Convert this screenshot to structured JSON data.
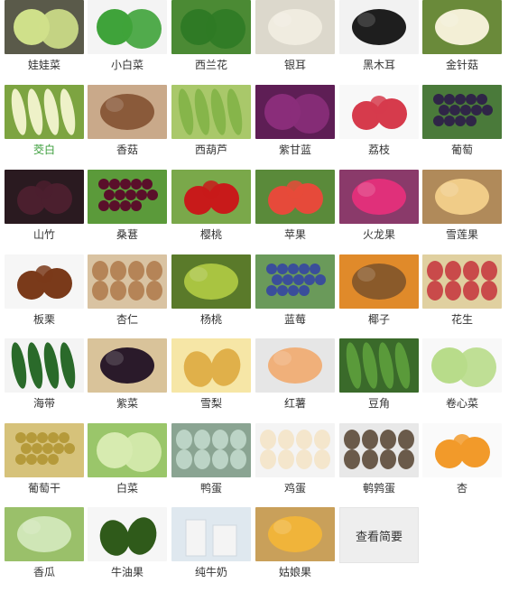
{
  "items": [
    {
      "name": "娃娃菜",
      "icon": "baby-cabbage-icon",
      "color": "#cfe08a",
      "bg": "#5a5a4a"
    },
    {
      "name": "小白菜",
      "icon": "bok-choy-icon",
      "color": "#3fa33a",
      "bg": "#f4f4f4"
    },
    {
      "name": "西兰花",
      "icon": "broccoli-icon",
      "color": "#2f7a25",
      "bg": "#4b8a34"
    },
    {
      "name": "银耳",
      "icon": "white-fungus-icon",
      "color": "#f0ece0",
      "bg": "#dcd8cc"
    },
    {
      "name": "黑木耳",
      "icon": "black-fungus-icon",
      "color": "#1e1e1e",
      "bg": "#f2f2f2"
    },
    {
      "name": "金针菇",
      "icon": "enoki-icon",
      "color": "#f3efd6",
      "bg": "#6a8a3a"
    },
    {
      "name": "茭白",
      "icon": "water-bamboo-icon",
      "color": "#eef1c8",
      "bg": "#7da441",
      "active": true
    },
    {
      "name": "香菇",
      "icon": "shiitake-icon",
      "color": "#8a5a3a",
      "bg": "#c9a98a"
    },
    {
      "name": "西葫芦",
      "icon": "zucchini-icon",
      "color": "#86b54a",
      "bg": "#a9c86a"
    },
    {
      "name": "紫甘蓝",
      "icon": "red-cabbage-icon",
      "color": "#8a2d7a",
      "bg": "#5e1e55"
    },
    {
      "name": "荔枝",
      "icon": "lychee-icon",
      "color": "#d63b4c",
      "bg": "#f8f8f8"
    },
    {
      "name": "葡萄",
      "icon": "grape-icon",
      "color": "#2f2547",
      "bg": "#4a7a3a"
    },
    {
      "name": "山竹",
      "icon": "mangosteen-icon",
      "color": "#4b1f2e",
      "bg": "#2a1a20"
    },
    {
      "name": "桑葚",
      "icon": "mulberry-icon",
      "color": "#5a0f2a",
      "bg": "#5b9a3a"
    },
    {
      "name": "樱桃",
      "icon": "cherry-icon",
      "color": "#c81a1a",
      "bg": "#7aa84a"
    },
    {
      "name": "苹果",
      "icon": "apple-icon",
      "color": "#e64a3a",
      "bg": "#5a8a3a"
    },
    {
      "name": "火龙果",
      "icon": "dragon-fruit-icon",
      "color": "#e0307a",
      "bg": "#8a3a6a"
    },
    {
      "name": "雪莲果",
      "icon": "yacon-icon",
      "color": "#f0cc88",
      "bg": "#b08a5a"
    },
    {
      "name": "板栗",
      "icon": "chestnut-icon",
      "color": "#7a3a1a",
      "bg": "#f6f6f6"
    },
    {
      "name": "杏仁",
      "icon": "almond-icon",
      "color": "#b58457",
      "bg": "#d9c3a2"
    },
    {
      "name": "杨桃",
      "icon": "starfruit-icon",
      "color": "#a9c441",
      "bg": "#5a7a2a"
    },
    {
      "name": "蓝莓",
      "icon": "blueberry-icon",
      "color": "#3a4e9a",
      "bg": "#6a9a5a"
    },
    {
      "name": "椰子",
      "icon": "coconut-icon",
      "color": "#8a5a2a",
      "bg": "#e08a2a"
    },
    {
      "name": "花生",
      "icon": "peanut-icon",
      "color": "#c94a4a",
      "bg": "#e0d0a0"
    },
    {
      "name": "海带",
      "icon": "kelp-icon",
      "color": "#2a6a2a",
      "bg": "#f4f4f4"
    },
    {
      "name": "紫菜",
      "icon": "nori-icon",
      "color": "#2a1a2a",
      "bg": "#d9c39a"
    },
    {
      "name": "雪梨",
      "icon": "pear-icon",
      "color": "#e0b04a",
      "bg": "#f6e6a6"
    },
    {
      "name": "红薯",
      "icon": "sweet-potato-icon",
      "color": "#f0b07a",
      "bg": "#e6e6e6"
    },
    {
      "name": "豆角",
      "icon": "green-bean-icon",
      "color": "#5a9a3a",
      "bg": "#3a6a2a"
    },
    {
      "name": "卷心菜",
      "icon": "cabbage-icon",
      "color": "#b8dc8a",
      "bg": "#f8f8f8"
    },
    {
      "name": "葡萄干",
      "icon": "raisin-icon",
      "color": "#b59a3a",
      "bg": "#d6c27a"
    },
    {
      "name": "白菜",
      "icon": "napa-cabbage-icon",
      "color": "#d7ebb0",
      "bg": "#9ac66a"
    },
    {
      "name": "鸭蛋",
      "icon": "duck-egg-icon",
      "color": "#bcd4c6",
      "bg": "#8aa492"
    },
    {
      "name": "鸡蛋",
      "icon": "chicken-egg-icon",
      "color": "#f4e6cc",
      "bg": "#f4f4f4"
    },
    {
      "name": "鹌鹑蛋",
      "icon": "quail-egg-icon",
      "color": "#6a5a4a",
      "bg": "#e8e8e8"
    },
    {
      "name": "杏",
      "icon": "apricot-icon",
      "color": "#f29a2a",
      "bg": "#fafafa"
    },
    {
      "name": "香瓜",
      "icon": "melon-icon",
      "color": "#cfe6b6",
      "bg": "#9ac06a"
    },
    {
      "name": "牛油果",
      "icon": "avocado-icon",
      "color": "#2f5a1a",
      "bg": "#f6f6f6"
    },
    {
      "name": "纯牛奶",
      "icon": "milk-icon",
      "color": "#f4f4f4",
      "bg": "#dfe8ef"
    },
    {
      "name": "姑娘果",
      "icon": "physalis-icon",
      "color": "#f0b43a",
      "bg": "#c9a05a"
    }
  ],
  "more_button": "查看简要"
}
